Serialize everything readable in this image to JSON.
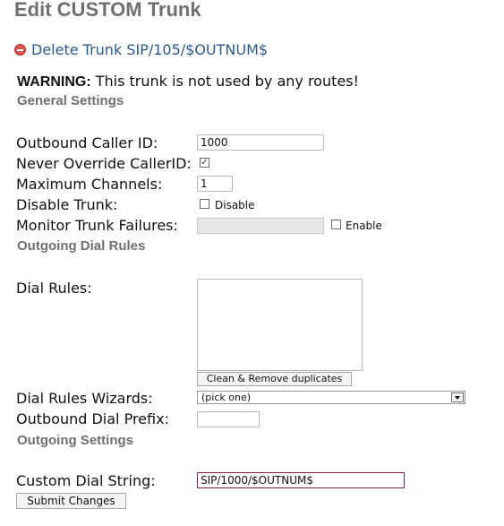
{
  "page": {
    "title": "Edit CUSTOM Trunk",
    "delete_link": "Delete Trunk SIP/105/$OUTNUM$",
    "warning_bold": "WARNING:",
    "warning_text": " This trunk is not used by any routes!"
  },
  "sections": {
    "general": "General Settings",
    "dial_rules": "Outgoing Dial Rules",
    "outgoing": "Outgoing Settings"
  },
  "general": {
    "outbound_cid_label": "Outbound Caller ID:",
    "outbound_cid_value": "1000",
    "never_override_label": "Never Override CallerID:",
    "never_override_checked": true,
    "max_channels_label": "Maximum Channels:",
    "max_channels_value": "1",
    "disable_trunk_label": "Disable Trunk:",
    "disable_checkbox_label": "Disable",
    "disable_checked": false,
    "monitor_label": "Monitor Trunk Failures:",
    "monitor_value": "",
    "enable_checkbox_label": "Enable",
    "enable_checked": false
  },
  "dial_rules": {
    "label": "Dial Rules:",
    "value": "",
    "clean_button": "Clean & Remove duplicates",
    "wizards_label": "Dial Rules Wizards:",
    "wizards_selected": "(pick one)",
    "prefix_label": "Outbound Dial Prefix:",
    "prefix_value": ""
  },
  "outgoing": {
    "dial_string_label": "Custom Dial String:",
    "dial_string_value": "SIP/1000/$OUTNUM$"
  },
  "actions": {
    "submit": "Submit Changes"
  },
  "icons": {
    "delete": "delete-icon",
    "checkmark": "checkmark-icon",
    "dropdown": "chevron-down-icon"
  }
}
